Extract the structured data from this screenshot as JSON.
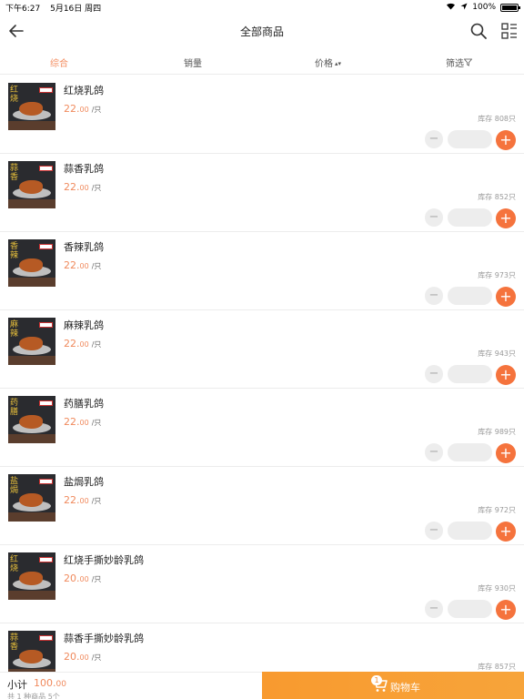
{
  "status": {
    "time": "下午6:27",
    "date": "5月16日 周四",
    "battery": "100%",
    "battery_level": 1.0
  },
  "header": {
    "title": "全部商品",
    "back_icon": "back-arrow-icon",
    "search_icon": "search-icon",
    "layout_icon": "grid-list-icon"
  },
  "filters": {
    "comprehensive": "综合",
    "sales": "销量",
    "price": "价格",
    "filter": "筛选"
  },
  "products": [
    {
      "name": "红烧乳鸽",
      "price_int": "22.",
      "price_dec": "00",
      "unit": "/只",
      "stock": "库存 808只",
      "tag": "红烧"
    },
    {
      "name": "蒜香乳鸽",
      "price_int": "22.",
      "price_dec": "00",
      "unit": "/只",
      "stock": "库存 852只",
      "tag": "蒜香"
    },
    {
      "name": "香辣乳鸽",
      "price_int": "22.",
      "price_dec": "00",
      "unit": "/只",
      "stock": "库存 973只",
      "tag": "香辣"
    },
    {
      "name": "麻辣乳鸽",
      "price_int": "22.",
      "price_dec": "00",
      "unit": "/只",
      "stock": "库存 943只",
      "tag": "麻辣"
    },
    {
      "name": "药膳乳鸽",
      "price_int": "22.",
      "price_dec": "00",
      "unit": "/只",
      "stock": "库存 989只",
      "tag": "药膳"
    },
    {
      "name": "盐焗乳鸽",
      "price_int": "22.",
      "price_dec": "00",
      "unit": "/只",
      "stock": "库存 972只",
      "tag": "盐焗"
    },
    {
      "name": "红烧手撕妙龄乳鸽",
      "price_int": "20.",
      "price_dec": "00",
      "unit": "/只",
      "stock": "库存 930只",
      "tag": "红烧"
    },
    {
      "name": "蒜香手撕妙龄乳鸽",
      "price_int": "20.",
      "price_dec": "00",
      "unit": "/只",
      "stock": "库存 857只",
      "tag": "蒜香"
    }
  ],
  "bottom": {
    "subtotal_label": "小计",
    "subtotal_int": "100.",
    "subtotal_dec": "00",
    "count_text": "共 1 种商品 5个",
    "cart_label": "购物车",
    "cart_badge": "1",
    "cart_color": "#f89a2f"
  },
  "colors": {
    "accent": "#f08a5d",
    "plus_button": "#f5733d"
  }
}
